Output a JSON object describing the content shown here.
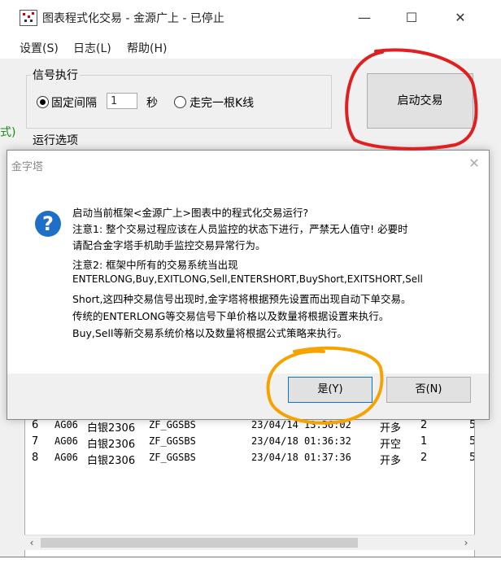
{
  "window": {
    "title": "图表程式化交易 - 金源广上 - 已停止",
    "minimize": "—",
    "maximize": "☐",
    "close": "✕"
  },
  "menu": [
    "设置(S)",
    "日志(L)",
    "帮助(H)"
  ],
  "signal_group": {
    "label": "信号执行",
    "fixed_interval_label": "固定间隔",
    "interval_value": "1",
    "seconds_label": "秒",
    "bar_complete_label": "走完一根K线",
    "selected": "fixed_interval"
  },
  "run_options_label": "运行选项",
  "start_button": "启动交易",
  "side_fragment": "式)",
  "table": {
    "rows": [
      {
        "no": "6",
        "code": "AG06",
        "name": "白银2306",
        "strategy": "ZF_GGSBS",
        "time": "23/04/14 13:36:02",
        "action": "开多",
        "qty": "2",
        "extra": "5"
      },
      {
        "no": "7",
        "code": "AG06",
        "name": "白银2306",
        "strategy": "ZF_GGSBS",
        "time": "23/04/18 01:36:32",
        "action": "开空",
        "qty": "1",
        "extra": "5"
      },
      {
        "no": "8",
        "code": "AG06",
        "name": "白银2306",
        "strategy": "ZF_GGSBS",
        "time": "23/04/18 01:37:36",
        "action": "开多",
        "qty": "2",
        "extra": "5"
      }
    ],
    "scroll_left": "‹",
    "scroll_right": "›"
  },
  "dialog": {
    "title": "金字塔",
    "close": "✕",
    "icon": "question-icon",
    "icon_glyph": "?",
    "lines": [
      "启动当前框架<金源广上>图表中的程式化交易运行?",
      "注意1: 整个交易过程应该在人员监控的状态下进行，严禁无人值守! 必要时",
      "请配合金字塔手机助手监控交易异常行为。",
      "注意2: 框架中所有的交易系统当出现",
      "ENTERLONG,Buy,EXITLONG,Sell,ENTERSHORT,BuyShort,EXITSHORT,Sell",
      "Short,这四种交易信号出现时,金字塔将根据预先设置而出现自动下单交易。",
      "传统的ENTERLONG等交易信号下单价格以及数量将根据设置来执行。",
      "Buy,Sell等新交易系统价格以及数量将根据公式策略来执行。"
    ],
    "yes_button": "是(Y)",
    "no_button": "否(N)"
  },
  "colors": {
    "red_annotation": "#e02020",
    "orange_annotation": "#f5a300",
    "question_icon": "#1d6fc7",
    "default_button_border": "#0078d7"
  }
}
